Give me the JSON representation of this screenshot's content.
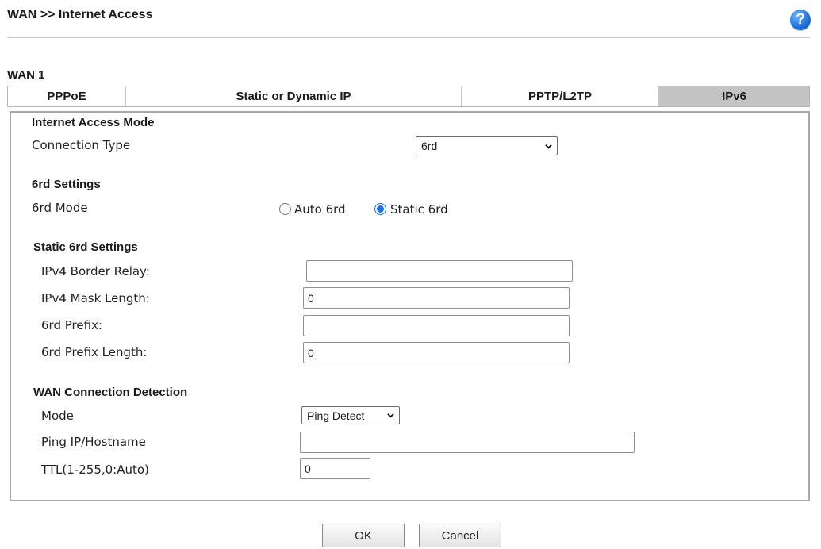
{
  "header": {
    "title": "WAN >> Internet Access",
    "help_glyph": "?"
  },
  "wan_label": "WAN 1",
  "tabs": [
    {
      "label": "PPPoE",
      "active": false
    },
    {
      "label": "Static or Dynamic IP",
      "active": false
    },
    {
      "label": "PPTP/L2TP",
      "active": false
    },
    {
      "label": "IPv6",
      "active": true
    }
  ],
  "internet_access": {
    "title": "Internet Access Mode",
    "connection_type_label": "Connection Type",
    "connection_type_value": "6rd"
  },
  "sixrd": {
    "title": "6rd Settings",
    "mode_label": "6rd Mode",
    "options": [
      {
        "label": "Auto 6rd",
        "checked": false
      },
      {
        "label": "Static 6rd",
        "checked": true
      }
    ]
  },
  "static6rd": {
    "title": "Static 6rd Settings",
    "border_relay_label": "IPv4 Border Relay:",
    "border_relay_value": "",
    "mask_length_label": "IPv4 Mask Length:",
    "mask_length_value": "0",
    "prefix_label": "6rd Prefix:",
    "prefix_value": "",
    "prefix_length_label": "6rd Prefix Length:",
    "prefix_length_value": "0"
  },
  "detection": {
    "title": "WAN Connection Detection",
    "mode_label": "Mode",
    "mode_value": "Ping Detect",
    "ping_label": "Ping IP/Hostname",
    "ping_value": "",
    "ttl_label": "TTL(1-255,0:Auto)",
    "ttl_value": "0"
  },
  "buttons": {
    "ok": "OK",
    "cancel": "Cancel"
  }
}
